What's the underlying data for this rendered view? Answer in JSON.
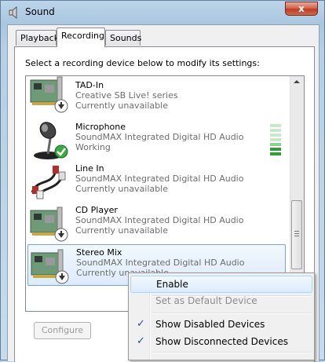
{
  "window": {
    "title": "Sound",
    "close_glyph": "x"
  },
  "tabs": [
    {
      "label": "Playback",
      "active": false
    },
    {
      "label": "Recording",
      "active": true
    },
    {
      "label": "Sounds",
      "active": false
    }
  ],
  "instruction": "Select a recording device below to modify its settings:",
  "devices": [
    {
      "name": "TAD-In",
      "description": "Creative SB Live! series",
      "status": "Currently unavailable",
      "icon": "sound-card-icon",
      "badge": "down-arrow-badge"
    },
    {
      "name": "Microphone",
      "description": "SoundMAX Integrated Digital HD Audio",
      "status": "Working",
      "icon": "microphone-icon",
      "badge": "check-badge"
    },
    {
      "name": "Line In",
      "description": "SoundMAX Integrated Digital HD Audio",
      "status": "Currently unavailable",
      "icon": "line-in-cable-icon",
      "badge": "down-arrow-badge"
    },
    {
      "name": "CD Player",
      "description": "SoundMAX Integrated Digital HD Audio",
      "status": "Currently unavailable",
      "icon": "sound-card-icon",
      "badge": "down-arrow-badge"
    },
    {
      "name": "Stereo Mix",
      "description": "SoundMAX Integrated Digital HD Audio",
      "status": "Currently unavailable",
      "icon": "sound-card-icon",
      "badge": "down-arrow-badge",
      "selected": true
    }
  ],
  "configure_label": "Configure",
  "context_menu": {
    "items": [
      {
        "label": "Enable",
        "enabled": true,
        "hover": true,
        "checked": false
      },
      {
        "label": "Set as Default Device",
        "enabled": false,
        "checked": false
      },
      {
        "label": "Show Disabled Devices",
        "enabled": true,
        "checked": true
      },
      {
        "label": "Show Disconnected Devices",
        "enabled": true,
        "checked": true
      }
    ]
  },
  "colors": {
    "selection": "#dcebfc",
    "meter_active": "#2f9e3a",
    "meter_inactive": "#c9e7cb",
    "check": "#1e4f9c"
  }
}
